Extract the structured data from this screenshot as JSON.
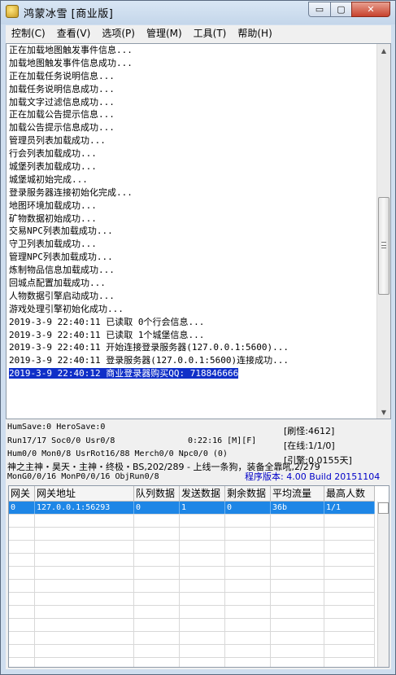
{
  "window": {
    "title": "鸿蒙冰雪 [商业版]",
    "controls": {
      "minimize": "▭",
      "maximize": "▢",
      "close": "✕"
    }
  },
  "menu": [
    "控制(C)",
    "查看(V)",
    "选项(P)",
    "管理(M)",
    "工具(T)",
    "帮助(H)"
  ],
  "log": {
    "lines": [
      "正在加载地图触发事件信息...",
      "加载地图触发事件信息成功...",
      "正在加载任务说明信息...",
      "加载任务说明信息成功...",
      "加载文字过滤信息成功...",
      "正在加载公告提示信息...",
      "加载公告提示信息成功...",
      "管理员列表加载成功...",
      "行会列表加载成功...",
      "城堡列表加载成功...",
      "城堡城初始完成...",
      "登录服务器连接初始化完成...",
      "地图环境加载成功...",
      "矿物数据初始成功...",
      "交易NPC列表加载成功...",
      "守卫列表加载成功...",
      "管理NPC列表加载成功...",
      "炼制物品信息加载成功...",
      "回城点配置加载成功...",
      "人物数据引擎启动成功...",
      "游戏处理引擎初始化成功...",
      "2019-3-9 22:40:11 已读取 0个行会信息...",
      "2019-3-9 22:40:11 已读取 1个城堡信息...",
      "2019-3-9 22:40:11 开始连接登录服务器(127.0.0.1:5600)...",
      "2019-3-9 22:40:11 登录服务器(127.0.0.1:5600)连接成功...",
      "2019-3-9 22:40:12 商业登录器购买QQ: 718846666"
    ],
    "selected_index": 25
  },
  "status": {
    "humsave": "HumSave:0 HeroSave:0",
    "run": "Run17/17 Soc0/0 Usr0/8",
    "time": "0:22:16 [M][F]",
    "shuaguai": "[刷怪:4612]",
    "online": "[在线:1/1/0]",
    "hum": "Hum0/0 Mon0/8 UsrRot16/88 Merch0/0 Npc0/0 (0)",
    "yinshu": "[引擎:0.0155天]",
    "broadcast": "神之主神・昊天・主神・终极・BS,202/289 - 上线一条狗，装备全靠吼,2/279",
    "mon": "MonG0/0/16 MonP0/0/16 ObjRun0/8",
    "version": "程序版本: 4.00 Build 20151104"
  },
  "gateway_table": {
    "headers": [
      "网关",
      "网关地址",
      "队列数据",
      "发送数据",
      "剩余数据",
      "平均流量",
      "最高人数"
    ],
    "rows": [
      [
        "0",
        "127.0.0.1:56293",
        "0",
        "1",
        "0",
        "36b",
        "1/1"
      ]
    ]
  },
  "colors": {
    "selection": "#1030c8",
    "row_highlight": "#1e86e6",
    "version_text": "#0000c8"
  }
}
